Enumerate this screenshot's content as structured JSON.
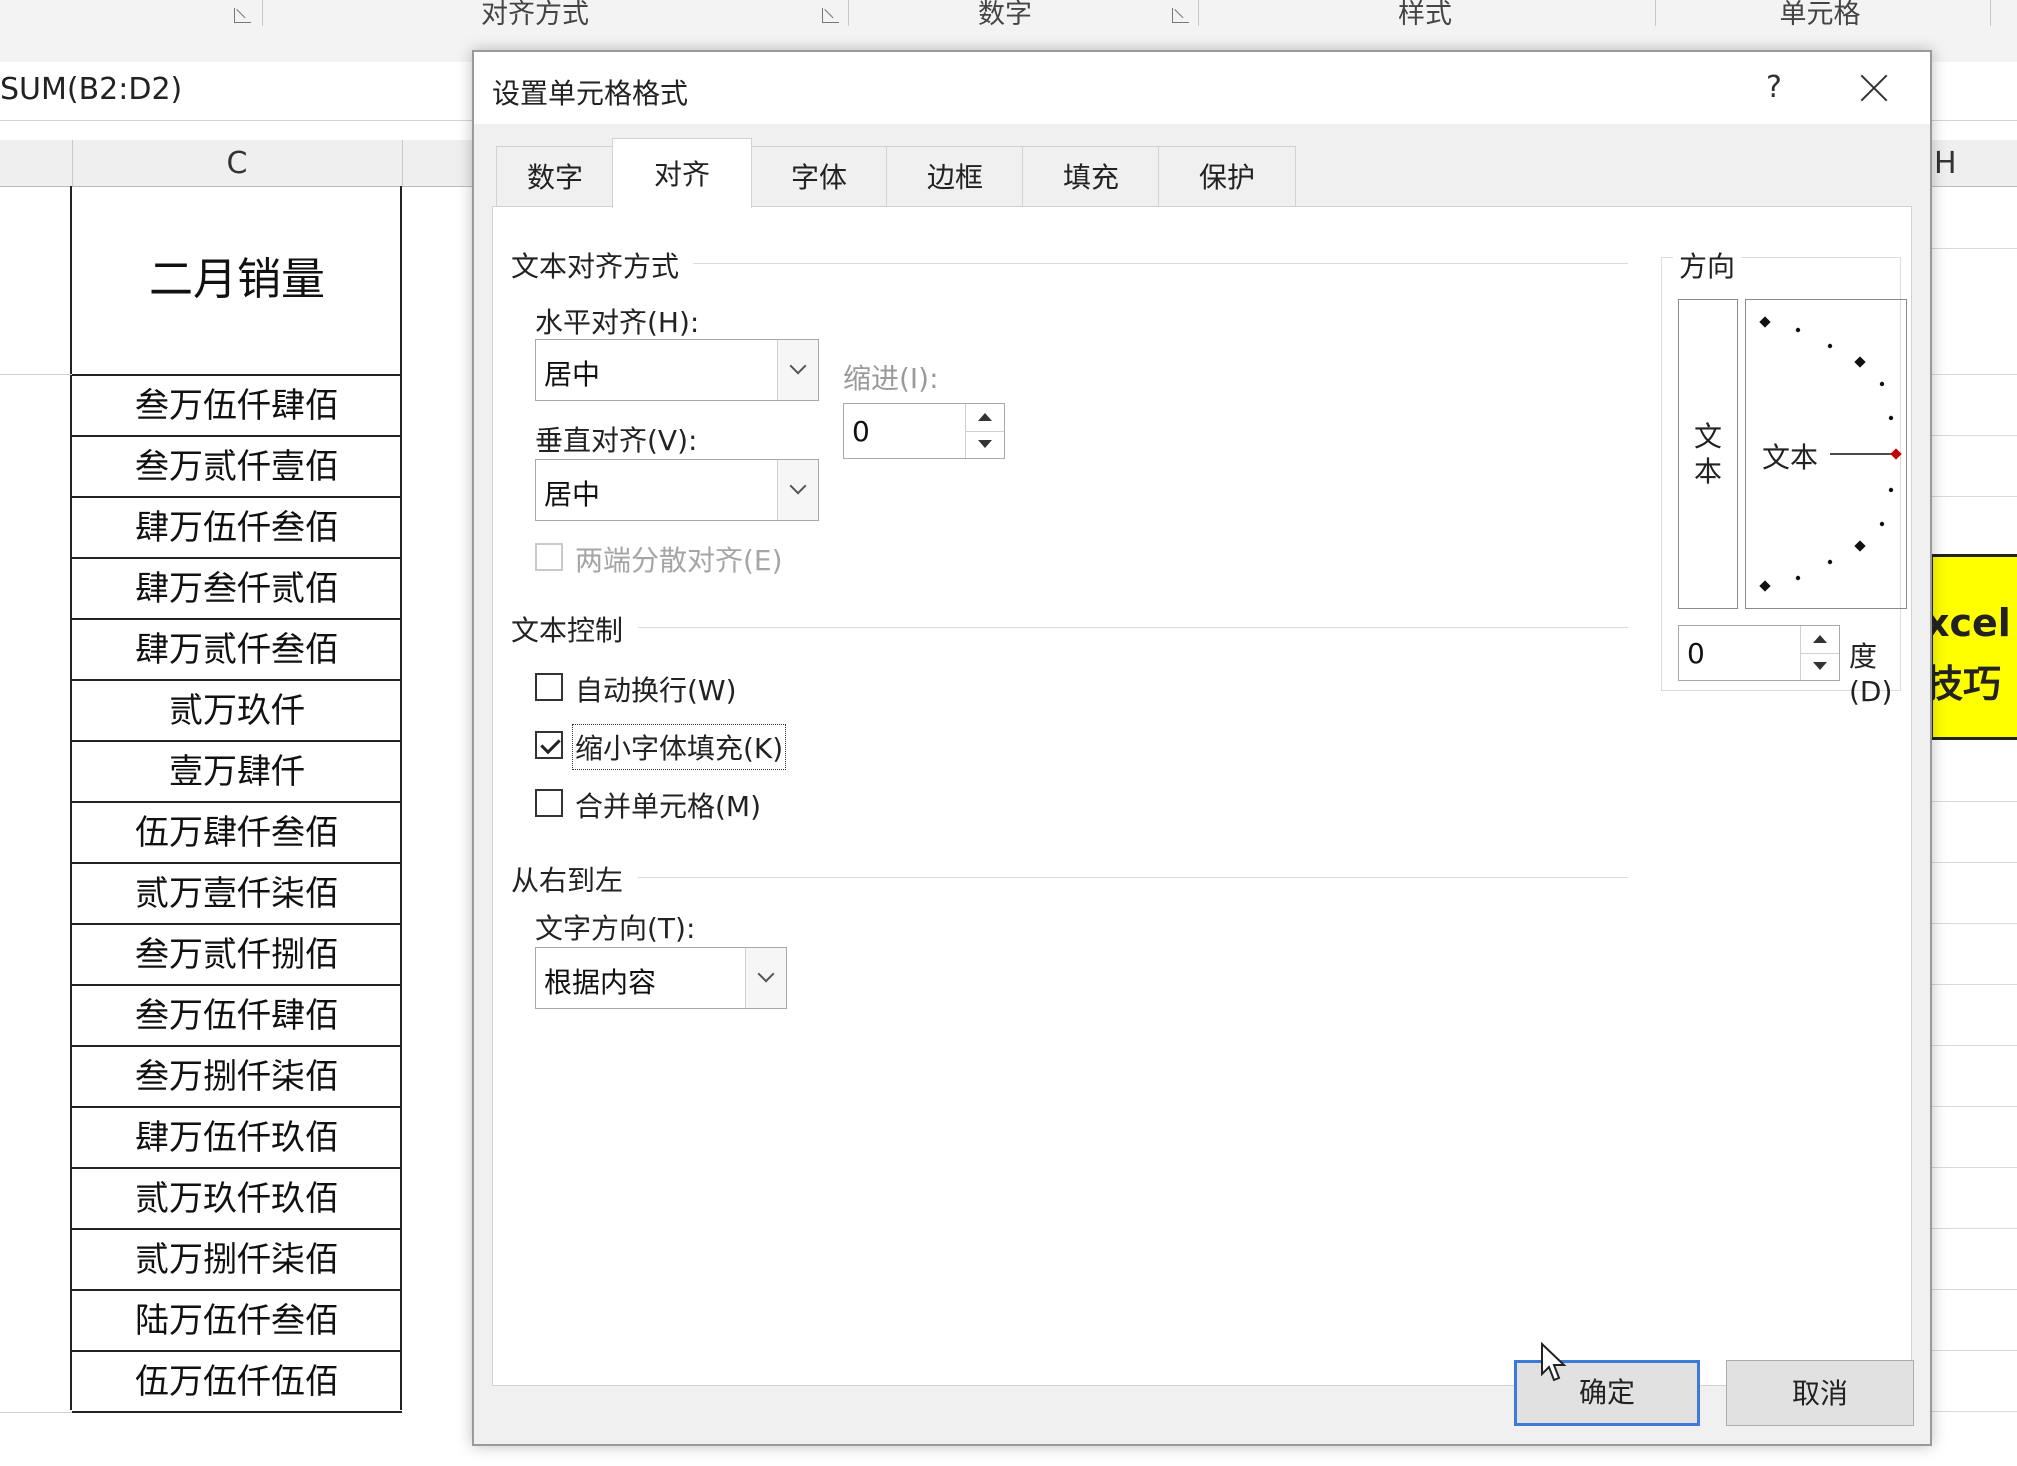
{
  "ribbon": {
    "groups": [
      "对齐方式",
      "数字",
      "样式",
      "单元格"
    ]
  },
  "formula_bar": {
    "text": "SUM(B2:D2)"
  },
  "sheet": {
    "columns": [
      "C",
      "H"
    ],
    "header_cell": "二月销量",
    "rows": [
      "叁万伍仟肆佰",
      "叁万贰仟壹佰",
      "肆万伍仟叁佰",
      "肆万叁仟贰佰",
      "肆万贰仟叁佰",
      "贰万玖仟",
      "壹万肆仟",
      "伍万肆仟叁佰",
      "贰万壹仟柒佰",
      "叁万贰仟捌佰",
      "叁万伍仟肆佰",
      "叁万捌仟柒佰",
      "肆万伍仟玖佰",
      "贰万玖仟玖佰",
      "贰万捌仟柒佰",
      "陆万伍仟叁佰",
      "伍万伍仟伍佰"
    ],
    "yellow_cell": {
      "line1": "xcel",
      "line2": "技巧",
      "color": "#ffff00"
    }
  },
  "dialog": {
    "title": "设置单元格格式",
    "help": "?",
    "tabs": [
      "数字",
      "对齐",
      "字体",
      "边框",
      "填充",
      "保护"
    ],
    "active_tab": "对齐",
    "text_alignment": {
      "section_title": "文本对齐方式",
      "horizontal_label": "水平对齐(H):",
      "horizontal_value": "居中",
      "indent_label": "缩进(I):",
      "indent_value": "0",
      "vertical_label": "垂直对齐(V):",
      "vertical_value": "居中",
      "justify_distributed_label": "两端分散对齐(E)"
    },
    "text_control": {
      "section_title": "文本控制",
      "wrap_text": {
        "label": "自动换行(W)",
        "checked": false
      },
      "shrink_to_fit": {
        "label": "缩小字体填充(K)",
        "checked": true
      },
      "merge_cells": {
        "label": "合并单元格(M)",
        "checked": false
      }
    },
    "rtl": {
      "section_title": "从右到左",
      "direction_label": "文字方向(T):",
      "direction_value": "根据内容"
    },
    "orientation": {
      "section_title": "方向",
      "vertical_text": [
        "文",
        "本"
      ],
      "dial_text": "文本",
      "degrees_value": "0",
      "degrees_label": "度(D)",
      "dial_marker_color": "#c00000"
    },
    "ok_label": "确定",
    "cancel_label": "取消",
    "default_button_border": "#3d7bd6"
  }
}
